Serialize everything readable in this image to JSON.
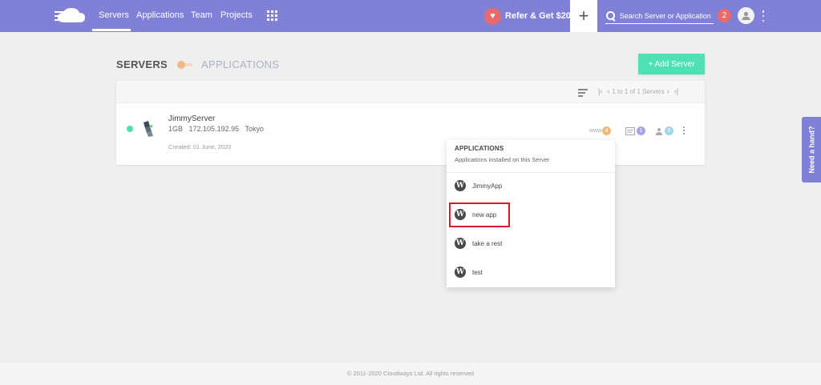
{
  "nav": {
    "logo_icon": "cloudways-logo-icon",
    "links": [
      {
        "label": "Servers",
        "active": true
      },
      {
        "label": "Applications"
      },
      {
        "label": "Team"
      },
      {
        "label": "Projects"
      }
    ],
    "apps_grid_icon": "grid-icon",
    "refer_label": "Refer & Get $20",
    "add_icon": "plus-icon",
    "search_placeholder": "Search Server or Application",
    "notification_count": "2",
    "accent_color": "#8080d6"
  },
  "page": {
    "tab_servers": "SERVERS",
    "tab_applications": "APPLICATIONS",
    "add_server_label": "+ Add Server"
  },
  "list": {
    "pagination": "1 to 1 of 1 Servers"
  },
  "server": {
    "status": "running",
    "status_color": "#4fe0a6",
    "name": "JimmyServer",
    "size": "1GB",
    "ip": "172.105.192.95",
    "location": "Tokyo",
    "created": "Created: 01 June, 2020",
    "www_label": "www",
    "apps_count": "4",
    "db_count": "1",
    "users_count": "0"
  },
  "dropdown": {
    "title": "APPLICATIONS",
    "subtitle": "Applications installed on this Server",
    "apps": [
      {
        "name": "JimmyApp"
      },
      {
        "name": "new app",
        "highlighted": true
      },
      {
        "name": "take a rest"
      },
      {
        "name": "test"
      }
    ]
  },
  "help_tab": "Need a hand?",
  "footer": "© 2011-2020 Cloudways Ltd. All rights reserved"
}
